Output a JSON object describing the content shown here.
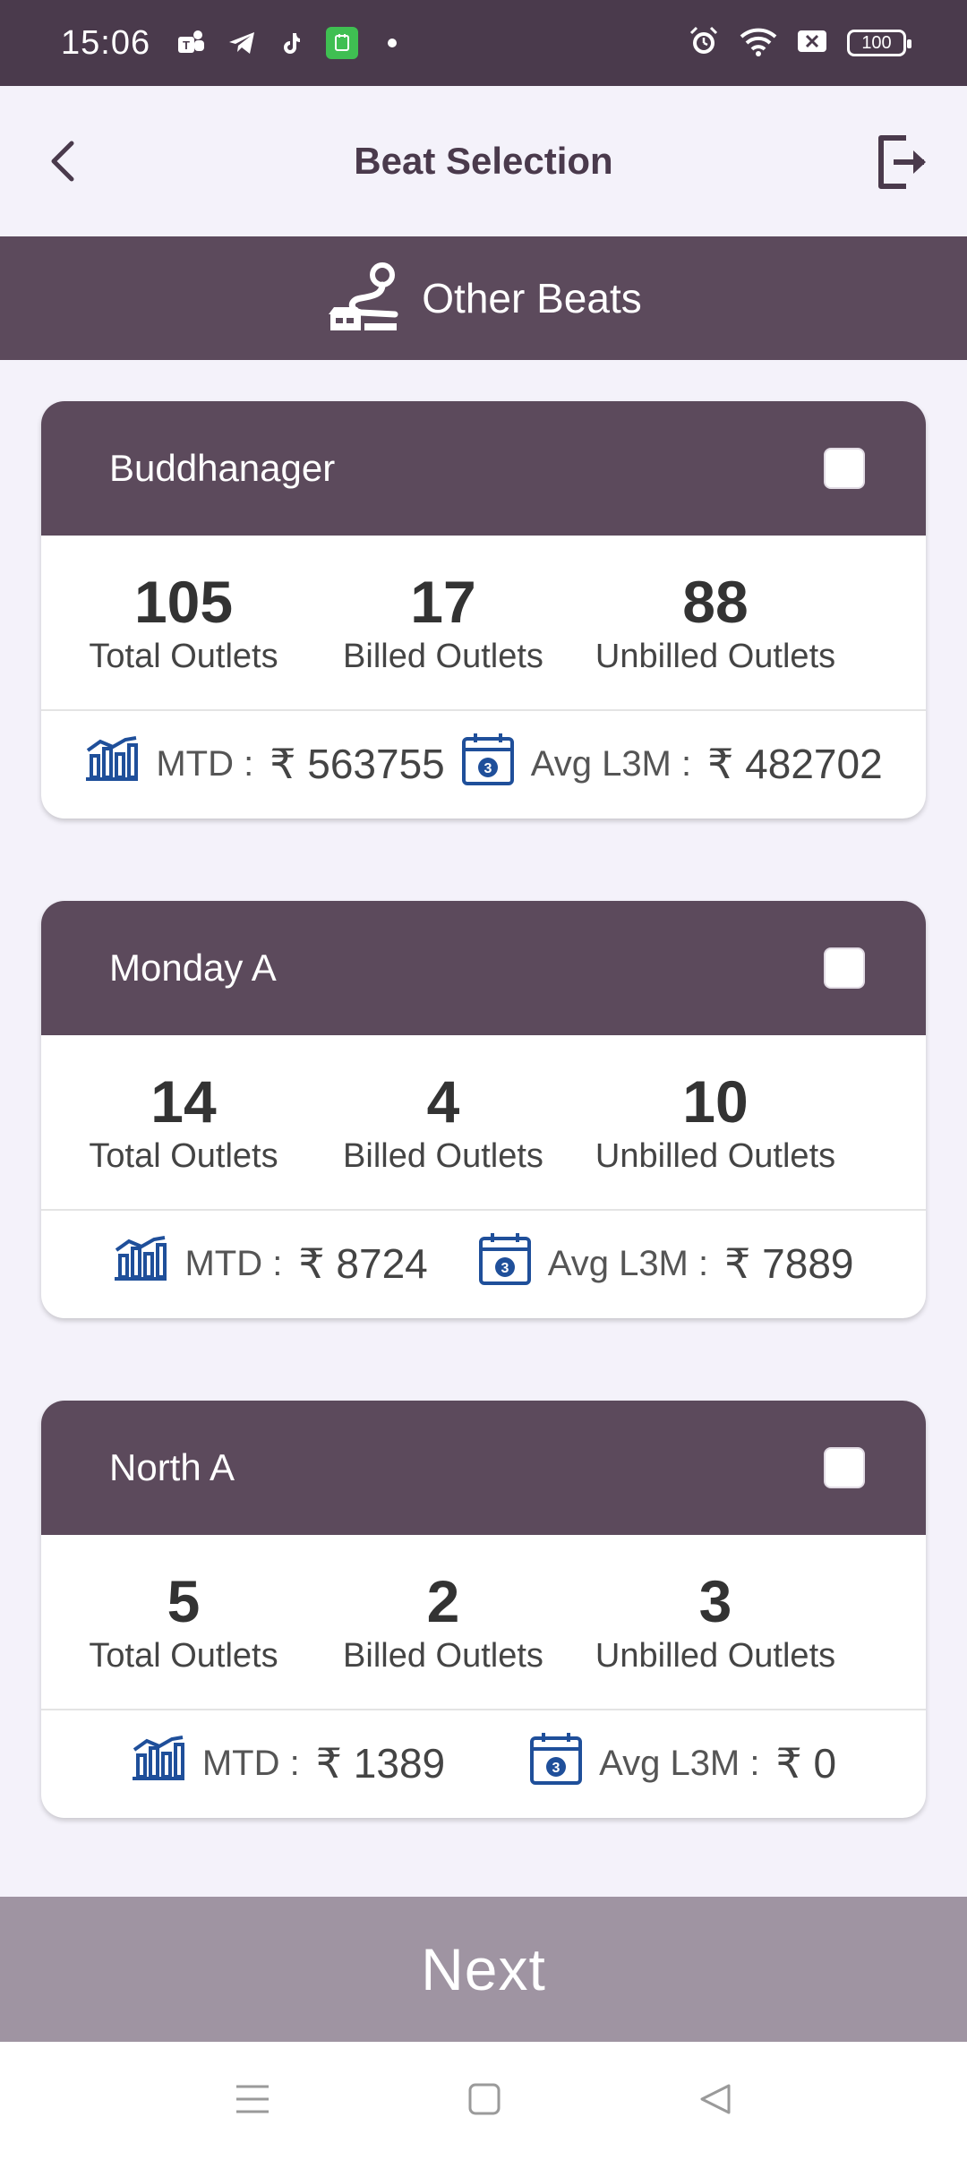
{
  "status_bar": {
    "time": "15:06",
    "battery": "100",
    "left_icons": [
      "teams-icon",
      "telegram-icon",
      "tiktok-icon",
      "green-app-icon",
      "dot-icon"
    ],
    "right_icons": [
      "alarm-icon",
      "wifi-icon",
      "sim-off-icon",
      "battery-icon"
    ]
  },
  "header": {
    "title": "Beat Selection",
    "back_icon": "chevron-left-icon",
    "logout_icon": "logout-icon"
  },
  "section": {
    "title": "Other Beats",
    "icon": "route-shop-icon"
  },
  "labels": {
    "total": "Total Outlets",
    "billed": "Billed Outlets",
    "unbilled": "Unbilled Outlets",
    "mtd": "MTD :",
    "avg": "Avg L3M :"
  },
  "beats": [
    {
      "name": "Buddhanager",
      "checked": false,
      "total": "105",
      "billed": "17",
      "unbilled": "88",
      "mtd": "₹ 563755",
      "avg": "₹ 482702"
    },
    {
      "name": "Monday A",
      "checked": false,
      "total": "14",
      "billed": "4",
      "unbilled": "10",
      "mtd": "₹ 8724",
      "avg": "₹ 7889"
    },
    {
      "name": "North A",
      "checked": false,
      "total": "5",
      "billed": "2",
      "unbilled": "3",
      "mtd": "₹ 1389",
      "avg": "₹ 0"
    }
  ],
  "next_button": {
    "label": "Next"
  },
  "colors": {
    "primary": "#5c4a5c",
    "status_bar": "#4a3a4c",
    "icon_blue": "#1f4f9a",
    "next_disabled": "#9f94a2",
    "background": "#f4f2fa"
  }
}
